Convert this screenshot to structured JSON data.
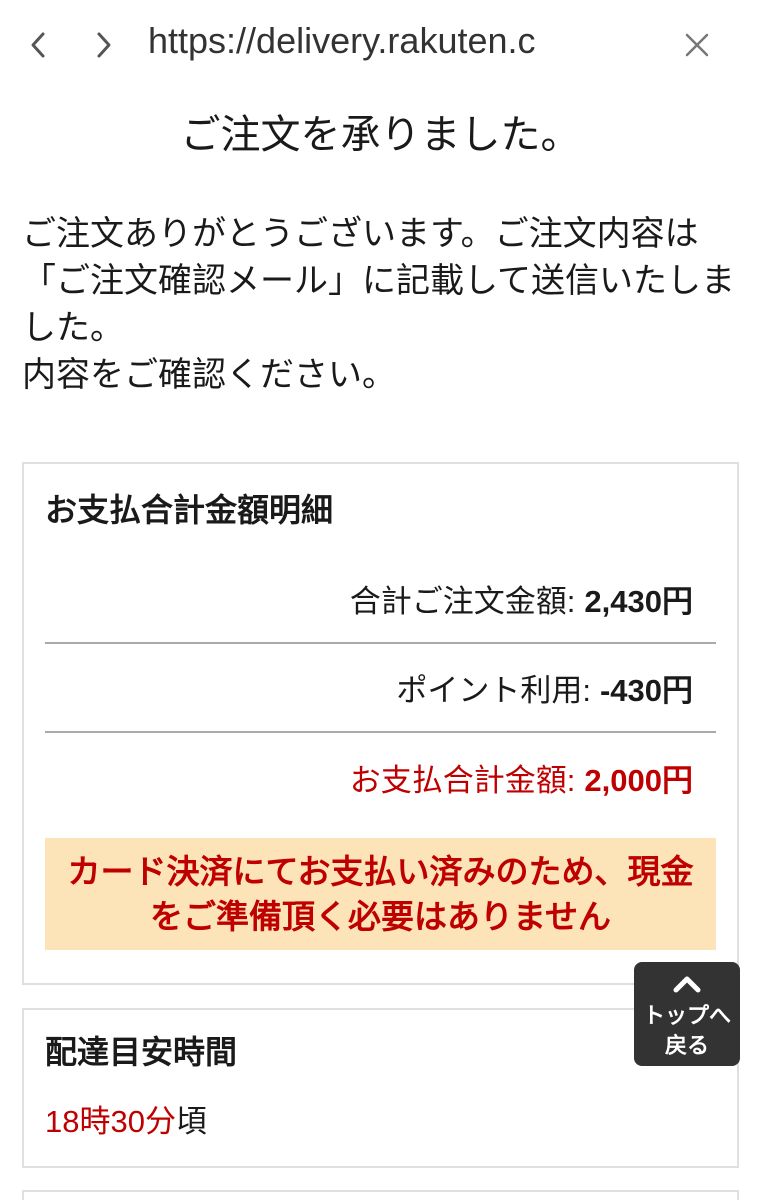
{
  "browser": {
    "url": "https://delivery.rakuten.c",
    "back_icon": "chevron-left-icon",
    "forward_icon": "chevron-right-icon",
    "close_icon": "close-icon"
  },
  "page": {
    "title": "ご注文を承りました。",
    "message": [
      "ご注文ありがとうございます。ご注文内容は「ご注文確認メール」に記載して送信いたしました。",
      "内容をご確認ください。"
    ]
  },
  "payment": {
    "heading": "お支払合計金額明細",
    "rows": [
      {
        "label": "合計ご注文金額:",
        "value": "2,430円"
      },
      {
        "label": "ポイント利用:",
        "value": "-430円"
      },
      {
        "label": "お支払合計金額:",
        "value": "2,000円"
      }
    ],
    "notice": "カード決済にてお支払い済みのため、現金をご準備頂く必要はありません"
  },
  "delivery": {
    "heading": "配達目安時間",
    "time": "18時30分",
    "suffix": "頃"
  },
  "back_to_top": {
    "icon": "chevron-up-icon",
    "line1": "トップへ",
    "line2": "戻る"
  },
  "colors": {
    "accent_red": "#bf0000",
    "notice_bg": "#fde3b8",
    "text": "#1a1a1a",
    "button_bg": "#333333"
  }
}
